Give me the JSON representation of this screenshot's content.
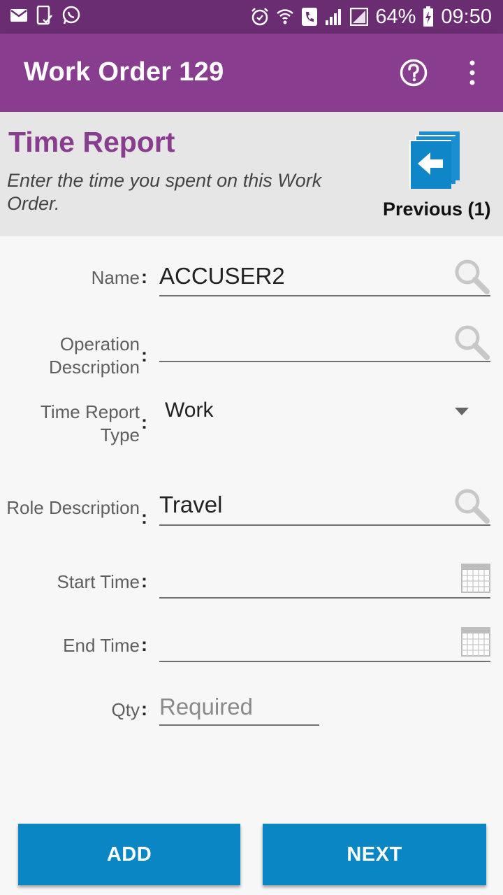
{
  "status_bar": {
    "battery": "64%",
    "time": "09:50",
    "left_icons": [
      "mail-icon",
      "phone-check-icon",
      "whatsapp-icon"
    ],
    "right_icons": [
      "alarm-icon",
      "wifi-call-icon",
      "call-icon",
      "signal-icon",
      "signal-empty-icon",
      "battery-charging-icon"
    ]
  },
  "app_bar": {
    "title": "Work Order 129",
    "actions": [
      "help-icon",
      "overflow-menu-icon"
    ]
  },
  "header": {
    "title": "Time Report",
    "subtitle": "Enter the time you spent on this Work Order.",
    "previous_label": "Previous (1)"
  },
  "form": {
    "name": {
      "label": "Name",
      "value": "ACCUSER2"
    },
    "operation": {
      "label": "Operation Description",
      "value": ""
    },
    "type": {
      "label": "Time Report Type",
      "value": "Work"
    },
    "role": {
      "label": "Role Description",
      "value": "Travel"
    },
    "start": {
      "label": "Start Time",
      "value": ""
    },
    "end": {
      "label": "End Time",
      "value": ""
    },
    "qty": {
      "label": "Qty",
      "placeholder": "Required"
    }
  },
  "buttons": {
    "add": "ADD",
    "next": "NEXT"
  },
  "colors": {
    "status_bar": "#6a2d72",
    "app_bar": "#883d8e",
    "accent": "#883d8e",
    "button": "#0b86c4"
  }
}
